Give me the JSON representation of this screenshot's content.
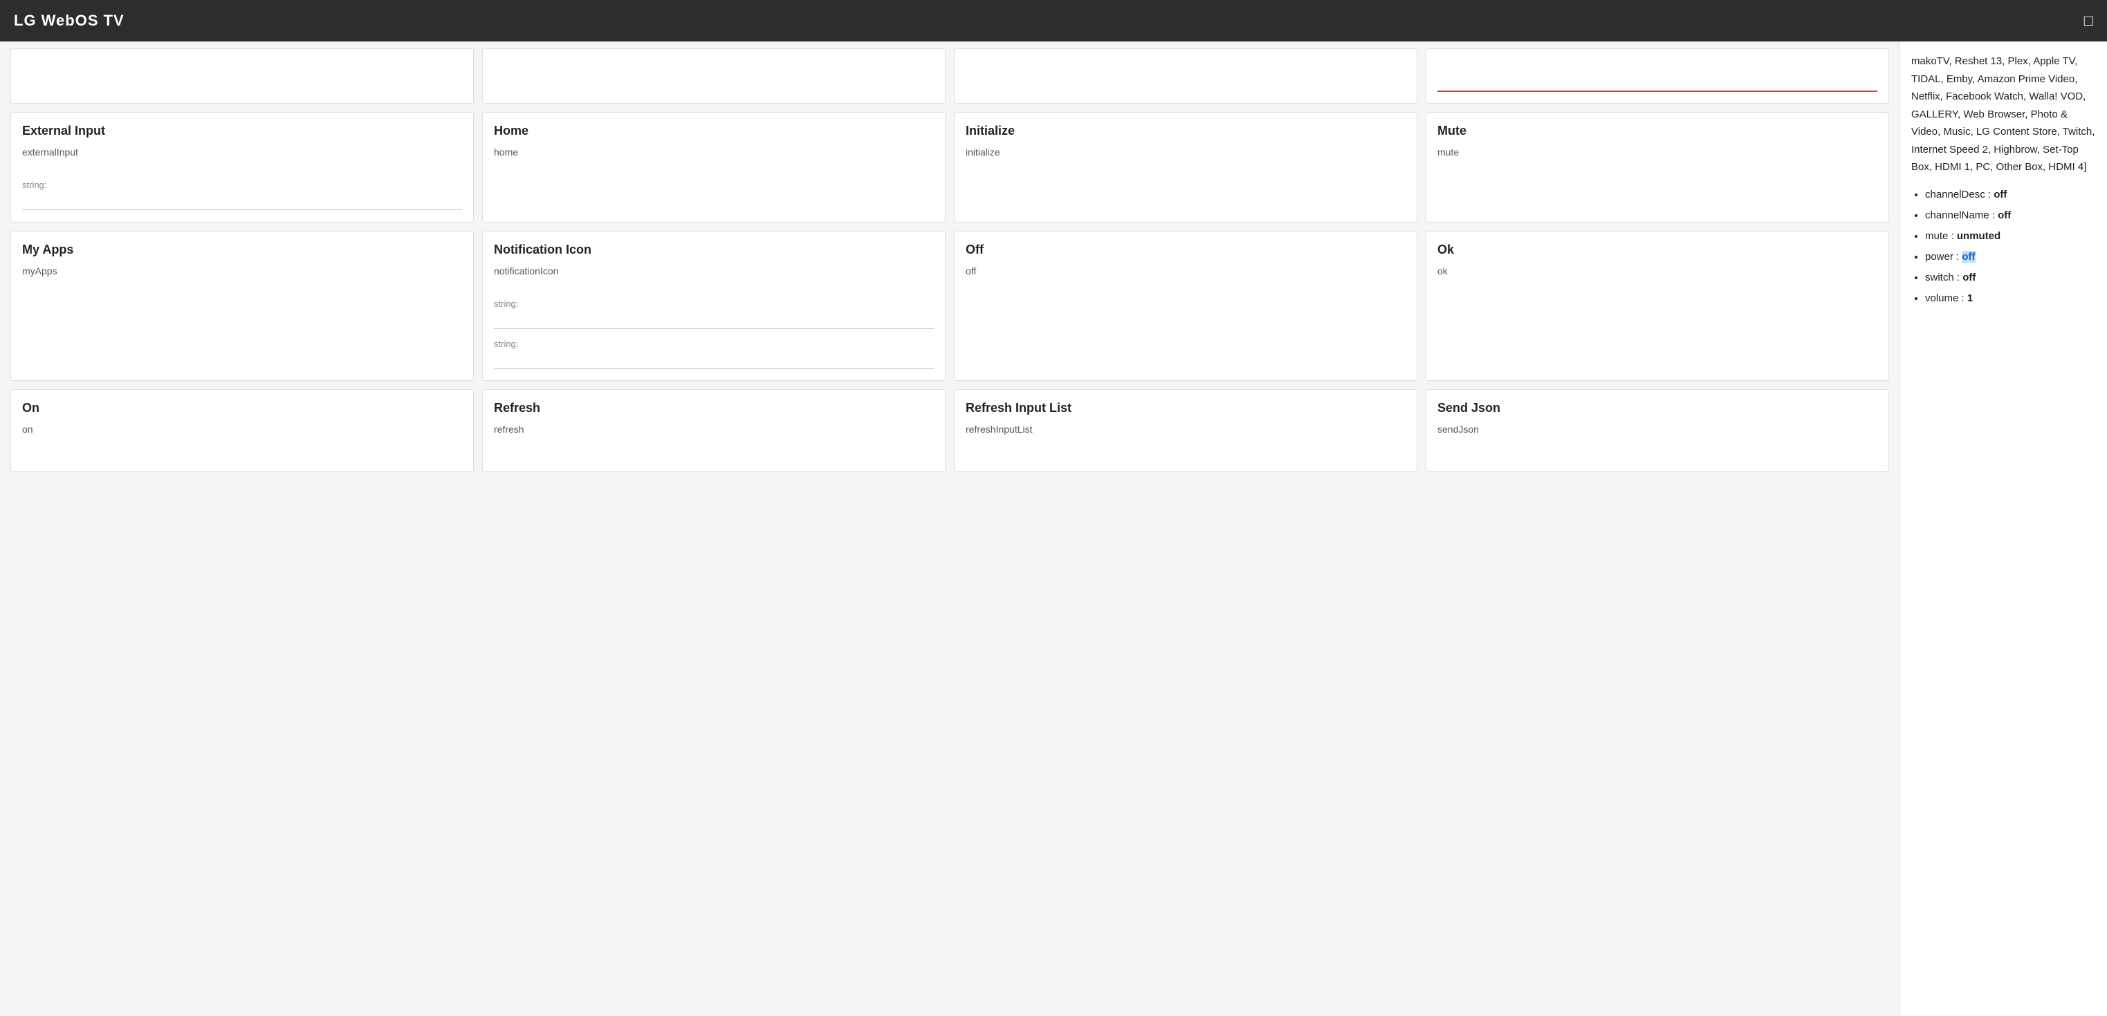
{
  "header": {
    "title": "LG WebOS TV",
    "chat_icon": "💬"
  },
  "sidebar": {
    "intro_text": "makoTV, Reshet 13, Plex, Apple TV, TIDAL, Emby, Amazon Prime Video, Netflix, Facebook Watch, Walla! VOD, GALLERY, Web Browser, Photo & Video, Music, LG Content Store, Twitch, Internet Speed 2, Highbrow, Set-Top Box, HDMI 1, PC, Other Box, HDMI 4]",
    "items": [
      {
        "key": "channelDesc",
        "value": "off"
      },
      {
        "key": "channelName",
        "value": "off"
      },
      {
        "key": "mute",
        "value": "unmuted"
      },
      {
        "key": "power",
        "value": "off",
        "highlight": true
      },
      {
        "key": "switch",
        "value": "off"
      },
      {
        "key": "volume",
        "value": "1"
      }
    ]
  },
  "grid": {
    "cards": [
      {
        "id": "card-external-input-top",
        "title": "",
        "key": "",
        "inputs": [],
        "partial": true
      },
      {
        "id": "card-home-top",
        "title": "",
        "key": "",
        "inputs": [],
        "partial": true
      },
      {
        "id": "card-initialize-top",
        "title": "",
        "key": "",
        "inputs": [],
        "partial": true
      },
      {
        "id": "card-mute-top",
        "title": "",
        "key": "",
        "inputs": [],
        "partial": true,
        "red_underline": true
      },
      {
        "id": "card-external-input",
        "title": "External Input",
        "key": "externalInput",
        "inputs": [
          {
            "label": "string:",
            "value": ""
          }
        ]
      },
      {
        "id": "card-home",
        "title": "Home",
        "key": "home",
        "inputs": []
      },
      {
        "id": "card-initialize",
        "title": "Initialize",
        "key": "initialize",
        "inputs": []
      },
      {
        "id": "card-mute",
        "title": "Mute",
        "key": "mute",
        "inputs": []
      },
      {
        "id": "card-my-apps",
        "title": "My Apps",
        "key": "myApps",
        "inputs": []
      },
      {
        "id": "card-notification-icon",
        "title": "Notification Icon",
        "key": "notificationIcon",
        "inputs": [
          {
            "label": "string:",
            "value": ""
          },
          {
            "label": "string:",
            "value": ""
          }
        ]
      },
      {
        "id": "card-off",
        "title": "Off",
        "key": "off",
        "inputs": []
      },
      {
        "id": "card-ok",
        "title": "Ok",
        "key": "ok",
        "inputs": []
      },
      {
        "id": "card-on",
        "title": "On",
        "key": "on",
        "inputs": [],
        "partial_bottom": true
      },
      {
        "id": "card-refresh",
        "title": "Refresh",
        "key": "refresh",
        "inputs": [],
        "partial_bottom": true
      },
      {
        "id": "card-refresh-input-list",
        "title": "Refresh Input List",
        "key": "refreshInputList",
        "inputs": [],
        "partial_bottom": true
      },
      {
        "id": "card-send-json",
        "title": "Send Json",
        "key": "sendJson",
        "inputs": [],
        "partial_bottom": true
      }
    ]
  }
}
